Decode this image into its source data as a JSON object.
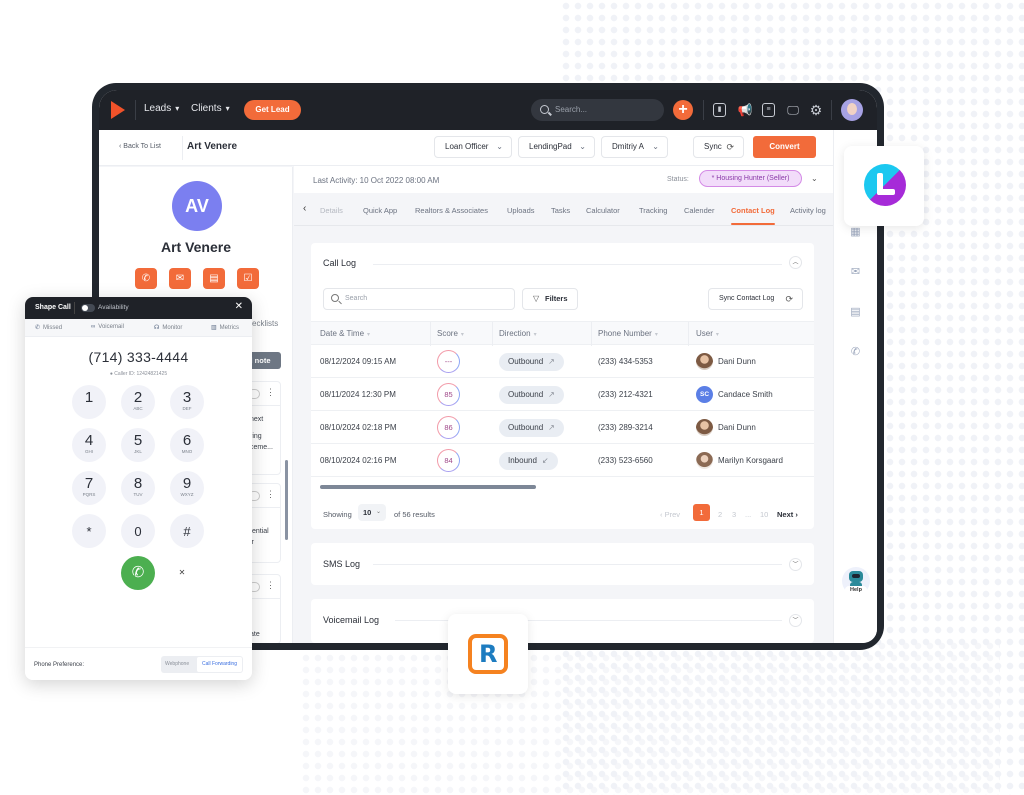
{
  "topnav": {
    "menu": [
      {
        "label": "Leads"
      },
      {
        "label": "Clients"
      }
    ],
    "get_lead": "Get Lead",
    "search_placeholder": "Search...",
    "plus": "+"
  },
  "subheader": {
    "back": "Back To List",
    "contact_name": "Art Venere",
    "dropdowns": [
      "Loan Officer",
      "LendingPad",
      "Dmitriy A"
    ],
    "sync": "Sync",
    "convert": "Convert"
  },
  "profile": {
    "initials": "AV",
    "name": "Art Venere",
    "checklists": "ecklists",
    "add_note": "d note",
    "notes": [
      {
        "lines": [
          "next",
          "ring",
          "ceme..."
        ]
      },
      {
        "lines": [
          "tential",
          "ir"
        ]
      },
      {
        "lines": [
          "ate"
        ]
      }
    ]
  },
  "activity": {
    "last_activity": "Last Activity: 10 Oct 2022 08:00 AM",
    "status_label": "Status:",
    "status_value": "* Housing Hunter (Seller)"
  },
  "tabs": [
    {
      "label": "Details",
      "state": "faded"
    },
    {
      "label": "Quick App"
    },
    {
      "label": "Realtors & Associates"
    },
    {
      "label": "Uploads"
    },
    {
      "label": "Tasks"
    },
    {
      "label": "Calculator"
    },
    {
      "label": "Tracking"
    },
    {
      "label": "Calender"
    },
    {
      "label": "Contact Log",
      "state": "active"
    },
    {
      "label": "Activity log"
    }
  ],
  "call_log": {
    "title": "Call Log",
    "search_placeholder": "Search",
    "filters": "Filters",
    "sync_contact_log": "Sync Contact Log",
    "columns": [
      "Date & Time",
      "Score",
      "Direction",
      "Phone Number",
      "User"
    ],
    "rows": [
      {
        "datetime": "08/12/2024 09:15 AM",
        "score": "---",
        "direction": "Outbound",
        "arrow": "↗",
        "phone": "(233) 434-5353",
        "user": "Dani Dunn",
        "avatar": "photo"
      },
      {
        "datetime": "08/11/2024 12:30 PM",
        "score": "85",
        "direction": "Outbound",
        "arrow": "↗",
        "phone": "(233) 212-4321",
        "user": "Candace Smith",
        "avatar": "SC"
      },
      {
        "datetime": "08/10/2024 02:18 PM",
        "score": "86",
        "direction": "Outbound",
        "arrow": "↗",
        "phone": "(233) 289-3214",
        "user": "Dani Dunn",
        "avatar": "photo"
      },
      {
        "datetime": "08/10/2024 02:16 PM",
        "score": "84",
        "direction": "Inbound",
        "arrow": "↙",
        "phone": "(233) 523-6560",
        "user": "Marilyn Korsgaard",
        "avatar": "photo2"
      }
    ],
    "showing": "Showing",
    "page_size": "10",
    "of_results": "of 56 results",
    "pagination": {
      "prev": "‹ Prev",
      "pages": [
        "1",
        "2",
        "3",
        "...",
        "10"
      ],
      "current": "1",
      "next": "Next ›"
    }
  },
  "sms_log": {
    "title": "SMS Log"
  },
  "voicemail_log": {
    "title": "Voicemail Log"
  },
  "rail": {
    "help": "Help"
  },
  "dialer": {
    "title": "Shape Call",
    "availability": "Availability",
    "tabs": [
      {
        "icon": "✆",
        "label": "Missed"
      },
      {
        "icon": "∞",
        "label": "Voicemail"
      },
      {
        "icon": "☊",
        "label": "Monitor"
      },
      {
        "icon": "▥",
        "label": "Metrics"
      }
    ],
    "number": "(714) 333-4444",
    "caller_id": "Caller ID: 12424821425",
    "keys": [
      {
        "d": "1",
        "l": ""
      },
      {
        "d": "2",
        "l": "ABC"
      },
      {
        "d": "3",
        "l": "DEF"
      },
      {
        "d": "4",
        "l": "GHI"
      },
      {
        "d": "5",
        "l": "JKL"
      },
      {
        "d": "6",
        "l": "MNO"
      },
      {
        "d": "7",
        "l": "PQRS"
      },
      {
        "d": "8",
        "l": "TUV"
      },
      {
        "d": "9",
        "l": "WXYZ"
      },
      {
        "d": "*",
        "l": ""
      },
      {
        "d": "0",
        "l": ""
      },
      {
        "d": "#",
        "l": ""
      }
    ],
    "phone_preference": "Phone Preference:",
    "pref_options": [
      "Webphone",
      "Call Forwarding"
    ],
    "pref_selected": "Call Forwarding"
  },
  "colors": {
    "accent": "#f26b3a",
    "nav_bg": "#1f2228",
    "call_green": "#4caf50",
    "avatar_purple": "#7b7ff0",
    "status_purple": "#8a3aa8"
  }
}
